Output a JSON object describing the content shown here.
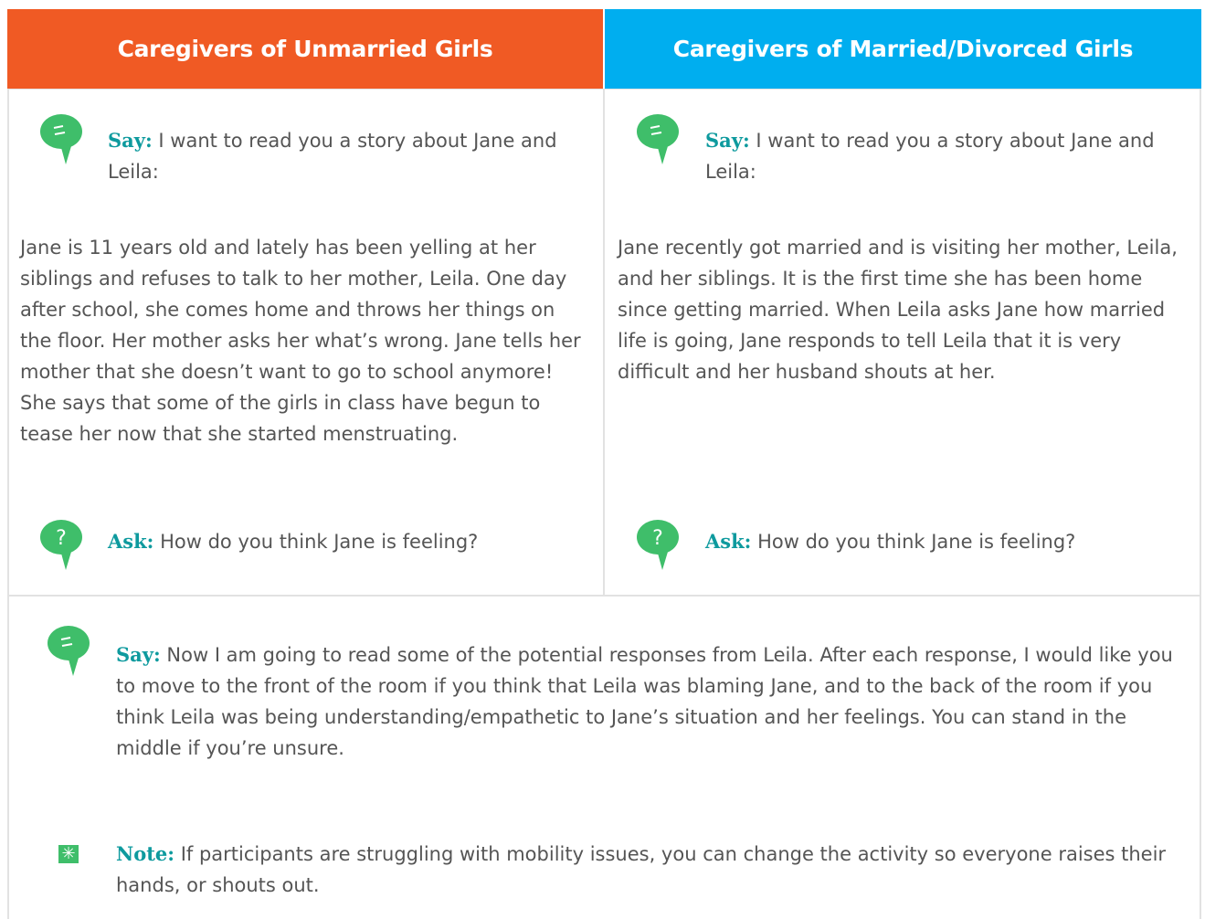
{
  "headers": {
    "left": "Caregivers of Unmarried Girls",
    "right": "Caregivers of Married/Divorced Girls"
  },
  "left": {
    "say_label": "Say:",
    "say_text": " I want to read you a story about Jane and Leila:",
    "story": "Jane is 11 years old and lately has been yelling at her siblings and refuses to talk to her mother, Leila. One day after school, she comes home and throws her things on the floor. Her mother asks her what’s wrong. Jane tells her mother that she doesn’t want to go to school anymore! She says that some of the girls in class have begun to tease her now that she started menstruating.",
    "ask_label": "Ask:",
    "ask_text": " How do you think Jane is feeling?"
  },
  "right": {
    "say_label": "Say:",
    "say_text": " I want to read you a story about Jane and Leila:",
    "story": "Jane recently got married and is visiting her mother, Leila, and her siblings. It is the first time she has been home since getting married. When Leila asks Jane how married life is going, Jane responds to tell Leila that it is very difficult and her husband shouts at her.",
    "ask_label": "Ask:",
    "ask_text": " How do you think Jane is feeling?"
  },
  "bottom": {
    "say_label": "Say:",
    "say_text": " Now I am going to read some of the potential responses from Leila. After each response, I would like you to move to the front of the room if you think that Leila was blaming Jane, and to the back of the room if you think Leila was being understanding/empathetic to Jane’s situation and her feelings. You can stand in the middle if you’re unsure.",
    "note_label": "Note:",
    "note_text": " If participants are struggling with mobility issues, you can change the activity so everyone raises their hands, or shouts out."
  },
  "colors": {
    "left_header": "#f05a24",
    "right_header": "#00aeef",
    "keyword": "#0e9a9e",
    "icon_green": "#3fbe6a"
  },
  "icons": {
    "say": "speech-bubble-icon",
    "ask": "question-bubble-icon",
    "note": "asterisk-note-icon"
  }
}
